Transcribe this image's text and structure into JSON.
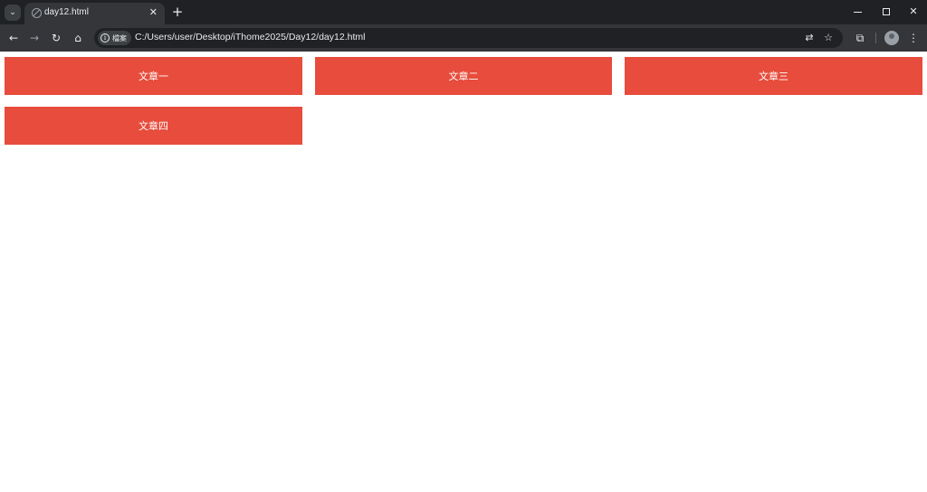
{
  "browser": {
    "tab_title": "day12.html",
    "url": "C:/Users/user/Desktop/iThome2025/Day12/day12.html",
    "site_chip_label": "檔案",
    "icons": {
      "tab_search": "chevron-down-icon",
      "favicon": "globe-icon",
      "tab_close": "close-icon",
      "new_tab": "plus-icon",
      "back": "arrow-left-icon",
      "forward": "arrow-right-icon",
      "reload": "reload-icon",
      "home": "home-icon",
      "info": "info-icon",
      "translate": "translate-icon",
      "bookmark": "star-icon",
      "extensions": "puzzle-icon",
      "profile": "avatar-icon",
      "menu": "kebab-menu-icon"
    }
  },
  "page": {
    "cards": [
      {
        "label": "文章一"
      },
      {
        "label": "文章二"
      },
      {
        "label": "文章三"
      },
      {
        "label": "文章四"
      }
    ],
    "card_color": "#e74c3c",
    "text_color": "#ffffff"
  }
}
